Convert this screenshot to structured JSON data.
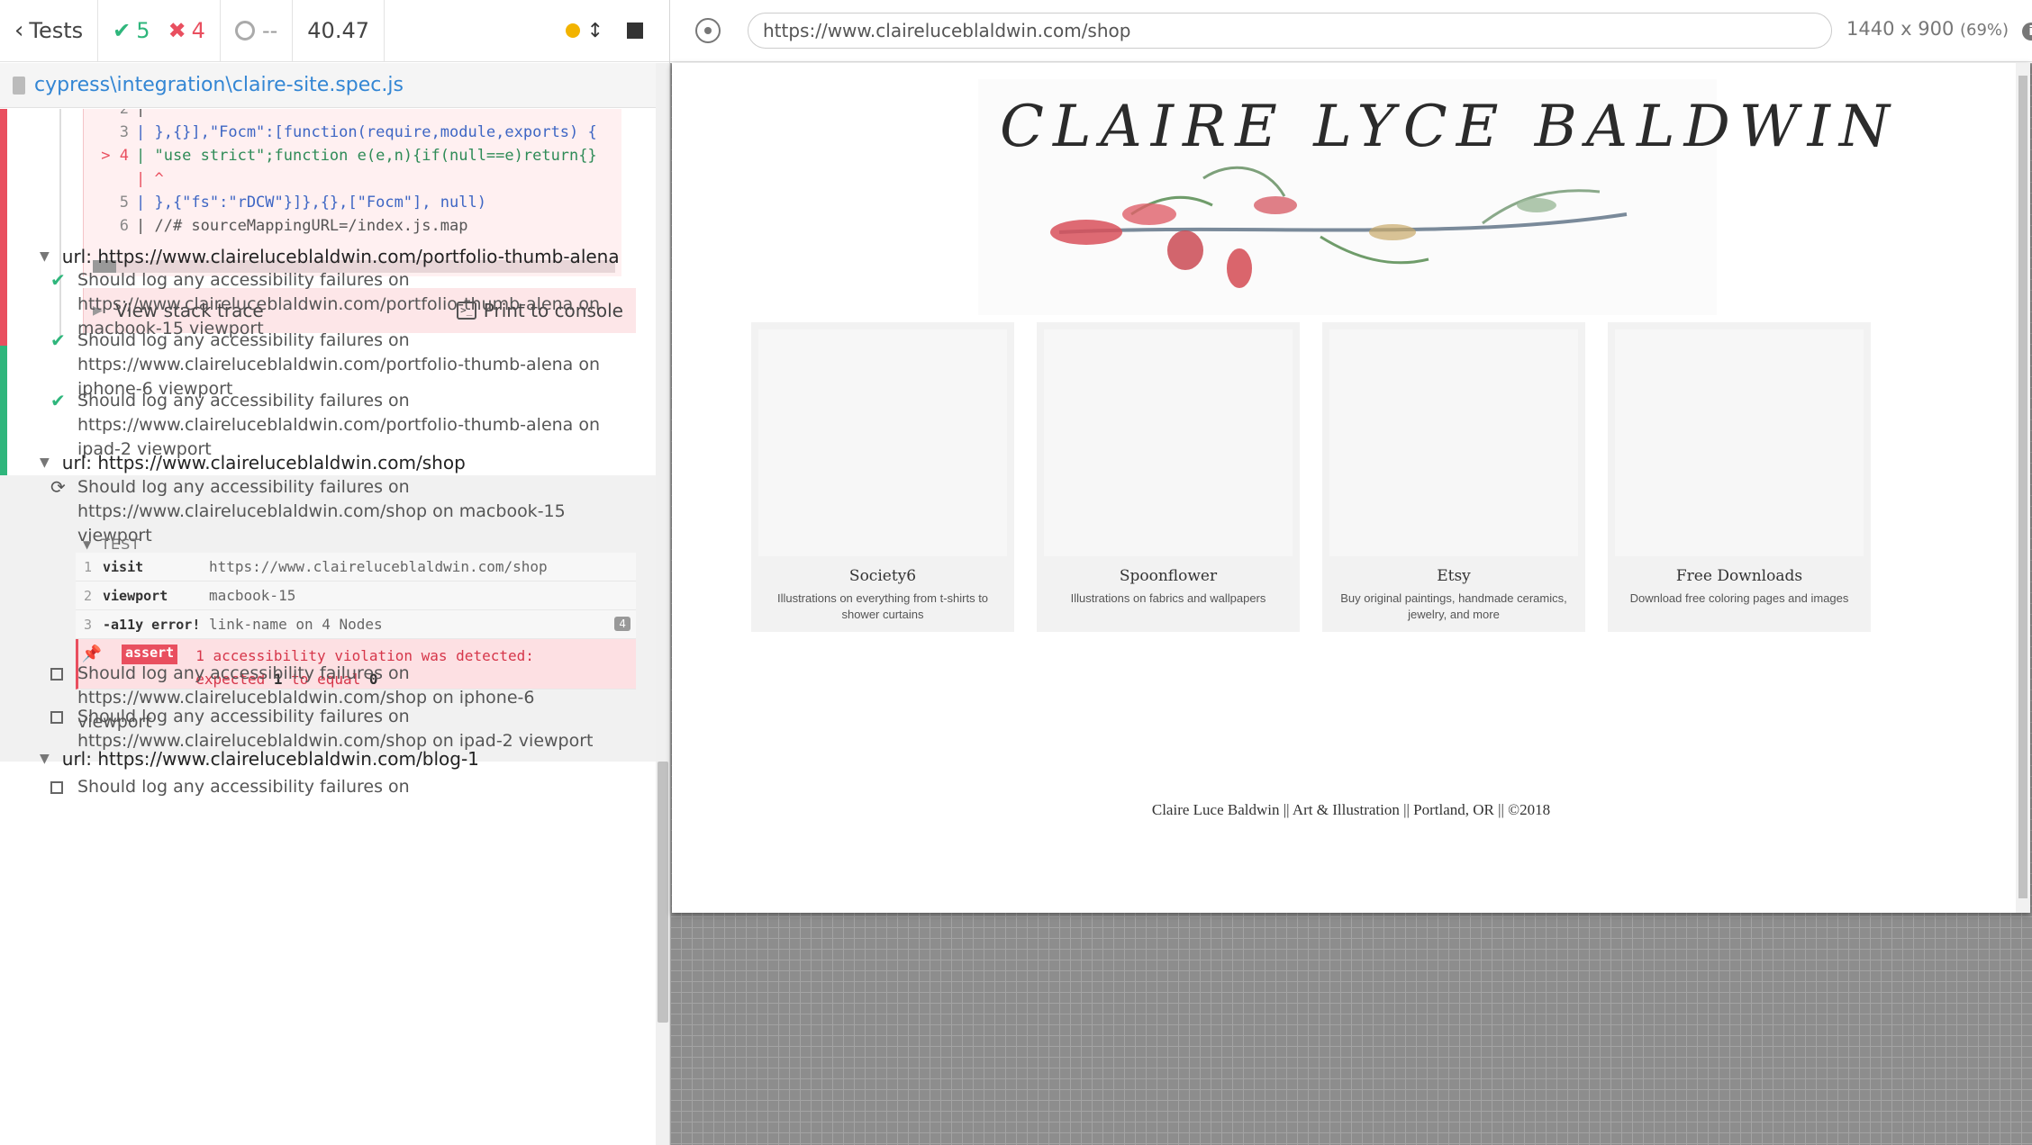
{
  "runner": {
    "back_label": "Tests",
    "passed": "5",
    "failed": "4",
    "pending": "--",
    "duration": "40.47",
    "spec_path": "cypress\\integration\\claire-site.spec.js"
  },
  "error_frame": {
    "lines": [
      {
        "num": "2",
        "text": "|"
      },
      {
        "num": "3",
        "text": "| },{}],\"Focm\":[function(require,module,exports) {"
      },
      {
        "num": "> 4",
        "text": "| \"use strict\";function e(e,n){if(null==e)return{}"
      },
      {
        "num": "",
        "text": "| ^"
      },
      {
        "num": "5",
        "text": "| },{\"fs\":\"rDCW\"}]},{},[\"Focm\"], null)"
      },
      {
        "num": "6",
        "text": "| //# sourceMappingURL=/index.js.map"
      }
    ],
    "view_stack_trace": "View stack trace",
    "print_to_console": "Print to console"
  },
  "suites": [
    {
      "title": "url: https://www.claireluceblaldwin.com/portfolio-thumb-alena",
      "tests": [
        {
          "state": "passed",
          "l1": "Should log any accessibility failures on",
          "l2": "https://www.claireluceblaldwin.com/portfolio-thumb-alena on",
          "l3": "macbook-15 viewport"
        },
        {
          "state": "passed",
          "l1": "Should log any accessibility failures on",
          "l2": "https://www.claireluceblaldwin.com/portfolio-thumb-alena on",
          "l3": "iphone-6 viewport"
        },
        {
          "state": "passed",
          "l1": "Should log any accessibility failures on",
          "l2": "https://www.claireluceblaldwin.com/portfolio-thumb-alena on",
          "l3": "ipad-2 viewport"
        }
      ]
    },
    {
      "title": "url: https://www.claireluceblaldwin.com/shop",
      "tests": [
        {
          "state": "running",
          "l1": "Should log any accessibility failures on",
          "l2": "https://www.claireluceblaldwin.com/shop on macbook-15",
          "l3": "viewport"
        },
        {
          "state": "pending",
          "l1": "Should log any accessibility failures on",
          "l2": "https://www.claireluceblaldwin.com/shop on iphone-6 viewport"
        },
        {
          "state": "pending",
          "l1": "Should log any accessibility failures on",
          "l2": "https://www.claireluceblaldwin.com/shop on ipad-2 viewport"
        }
      ]
    },
    {
      "title": "url: https://www.claireluceblaldwin.com/blog-1",
      "tests": [
        {
          "state": "pending",
          "l1": "Should log any accessibility failures on"
        }
      ]
    }
  ],
  "command_log": {
    "label": "TEST",
    "commands": [
      {
        "num": "1",
        "name": "visit",
        "message": "https://www.claireluceblaldwin.com/shop"
      },
      {
        "num": "2",
        "name": "viewport",
        "message": "macbook-15"
      },
      {
        "num": "3",
        "name": "-a11y error!",
        "message": "link-name on 4 Nodes",
        "badge": "4"
      }
    ],
    "assert": {
      "name": "assert",
      "line1": "1 accessibility violation was detected:",
      "expected": "expected",
      "value1": "1",
      "to_equal": "to equal",
      "value2": "0"
    }
  },
  "aut": {
    "url": "https://www.claireluceblaldwin.com/shop",
    "viewport": "1440 x 900",
    "scale": "(69%)"
  },
  "site": {
    "title": "CLAIRE LYCE BALDWIN",
    "cards": [
      {
        "title": "Society6",
        "desc": "Illustrations on everything from t-shirts to shower curtains"
      },
      {
        "title": "Spoonflower",
        "desc": "Illustrations on fabrics and wallpapers"
      },
      {
        "title": "Etsy",
        "desc": "Buy original paintings, handmade ceramics, jewelry, and more"
      },
      {
        "title": "Free Downloads",
        "desc": "Download free coloring pages and images"
      }
    ],
    "footer": "Claire Luce Baldwin || Art & Illustration || Portland, OR || ©2018"
  },
  "colors": {
    "pass": "#2fb67c",
    "fail": "#e94f5f",
    "link": "#3386d4",
    "running": "#f2b300"
  }
}
